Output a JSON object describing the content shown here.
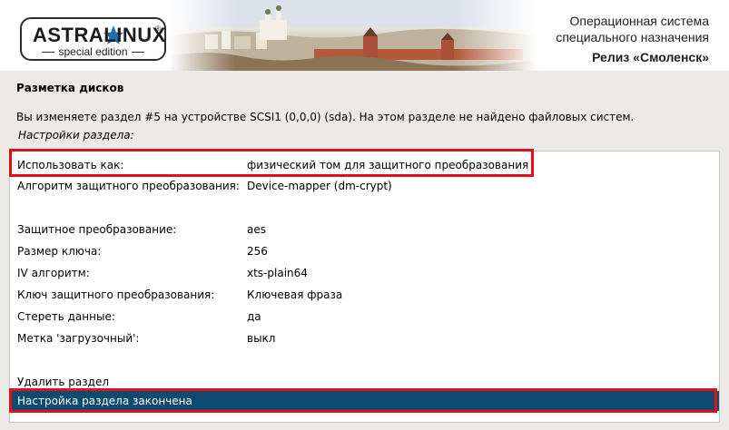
{
  "header": {
    "logo_text": "ASTRALINUX",
    "logo_reg": "®",
    "logo_subtitle": "special edition",
    "release_line1": "Операционная система",
    "release_line2": "специального назначения",
    "release_line3": "Релиз «Смоленск»"
  },
  "page": {
    "title": "Разметка дисков",
    "info": "Вы изменяете раздел #5 на устройстве SCSI1 (0,0,0) (sda). На этом разделе не найдено файловых систем.",
    "subtitle": "Настройки раздела:"
  },
  "settings": [
    {
      "key": "Использовать как:",
      "value": "физический том для защитного преобразования"
    },
    {
      "key": "Алгоритм защитного преобразования:",
      "value": "Device-mapper (dm-crypt)"
    },
    {
      "key": "Защитное преобразование:",
      "value": "aes"
    },
    {
      "key": "Размер ключа:",
      "value": "256"
    },
    {
      "key": "IV алгоритм:",
      "value": "xts-plain64"
    },
    {
      "key": "Ключ защитного преобразования:",
      "value": "Ключевая фраза"
    },
    {
      "key": "Стереть данные:",
      "value": "да"
    },
    {
      "key": "Метка 'загрузочный':",
      "value": "выкл"
    }
  ],
  "actions": {
    "delete_partition": "Удалить раздел",
    "done": "Настройка раздела закончена"
  },
  "colors": {
    "selection": "#0e4a72",
    "highlight_frame": "#e0101c",
    "background": "#eceae6"
  }
}
